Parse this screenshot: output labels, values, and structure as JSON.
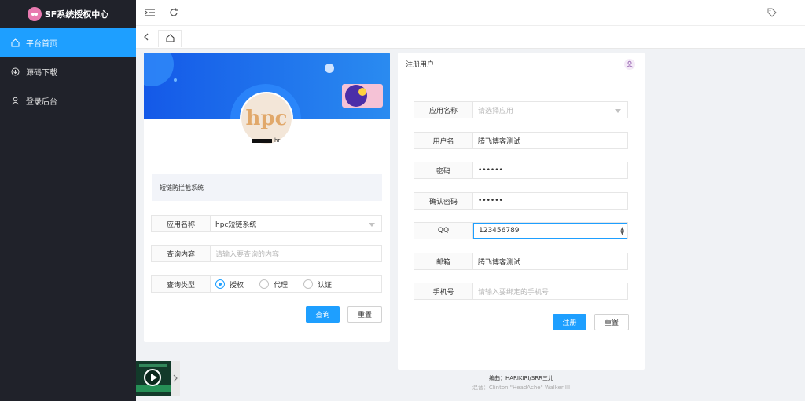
{
  "brand": {
    "title": "SF系统授权中心"
  },
  "sidebar": {
    "items": [
      {
        "label": "平台首页",
        "icon": "home-icon",
        "active": true
      },
      {
        "label": "源码下载",
        "icon": "download-icon",
        "active": false
      },
      {
        "label": "登录后台",
        "icon": "user-icon",
        "active": false
      }
    ]
  },
  "header": {
    "icons": [
      "menu-fold-icon",
      "refresh-icon",
      "tag-icon",
      "fullscreen-icon"
    ]
  },
  "query_card": {
    "avatar_text": "hpc",
    "username_suffix": "hr",
    "notice": "短链防拦截系统",
    "app_label": "应用名称",
    "app_value": "hpc短链系统",
    "content_label": "查询内容",
    "content_placeholder": "请输入要查询的内容",
    "type_label": "查询类型",
    "type_options": [
      "授权",
      "代理",
      "认证"
    ],
    "type_selected": "授权",
    "query_button": "查询",
    "reset_button": "重置"
  },
  "register_card": {
    "title": "注册用户",
    "app_label": "应用名称",
    "app_placeholder": "请选择应用",
    "username_label": "用户名",
    "username_value": "腾飞博客测试",
    "password_label": "密码",
    "password_value": "••••••",
    "confirm_label": "确认密码",
    "confirm_value": "••••••",
    "qq_label": "QQ",
    "qq_value": "123456789",
    "email_label": "邮箱",
    "email_value": "腾飞博客测试",
    "phone_label": "手机号",
    "phone_placeholder": "请输入要绑定的手机号",
    "register_button": "注册",
    "reset_button": "重置"
  },
  "footer": {
    "song": "编曲：HARIKIRI/SRR三儿",
    "singer": "混音：Clinton \"HeadAche\" Walker III"
  },
  "colors": {
    "accent": "#1e9fff",
    "sidebar_bg": "#20222a"
  }
}
